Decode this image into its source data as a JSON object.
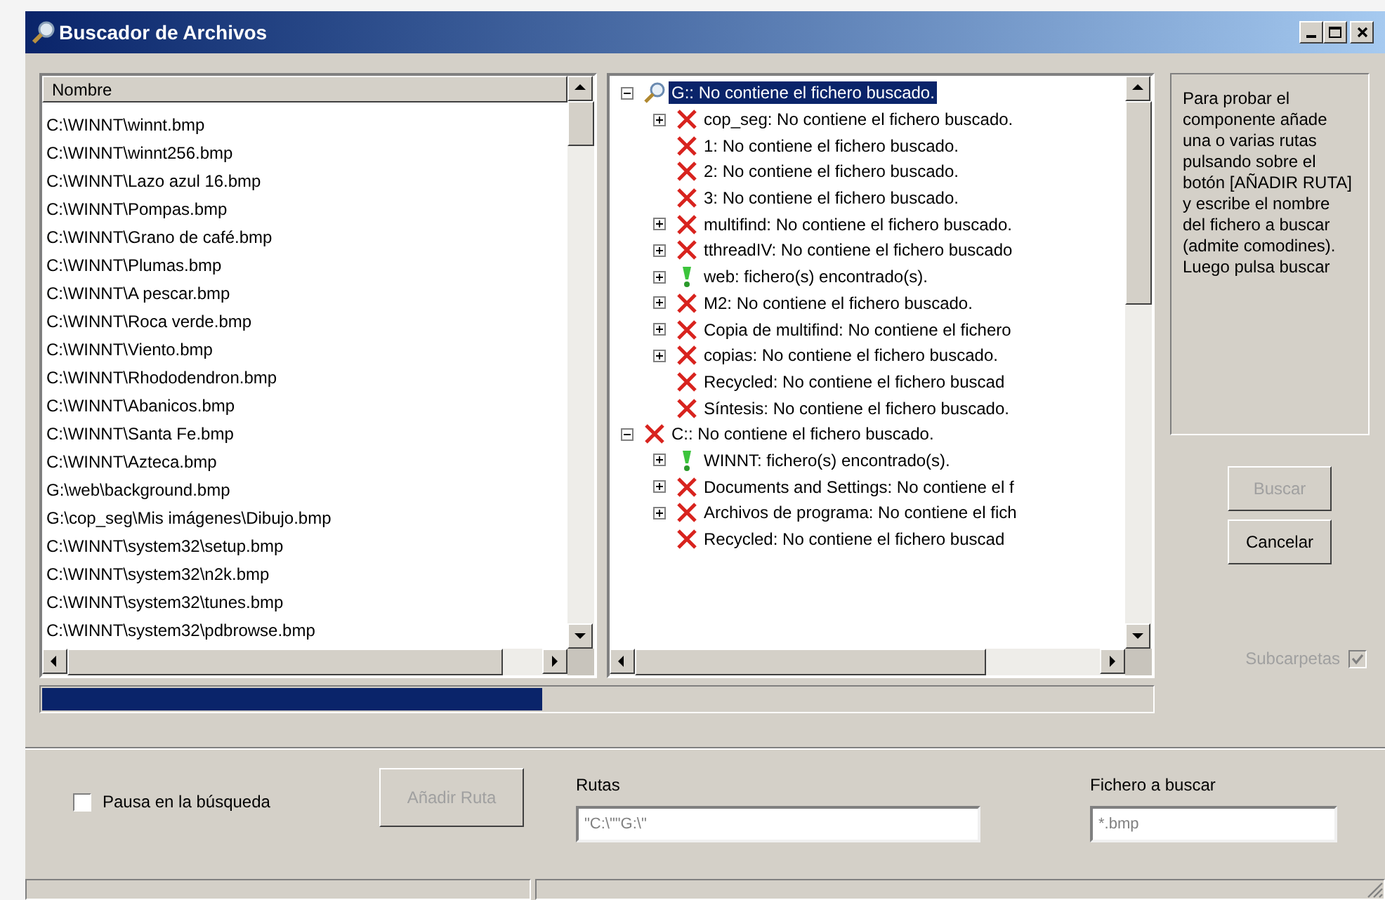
{
  "window": {
    "title": "Buscador de Archivos"
  },
  "file_list": {
    "column": "Nombre",
    "rows": [
      "C:\\WINNT\\winnt.bmp",
      "C:\\WINNT\\winnt256.bmp",
      "C:\\WINNT\\Lazo azul 16.bmp",
      "C:\\WINNT\\Pompas.bmp",
      "C:\\WINNT\\Grano de café.bmp",
      "C:\\WINNT\\Plumas.bmp",
      "C:\\WINNT\\A pescar.bmp",
      "C:\\WINNT\\Roca verde.bmp",
      "C:\\WINNT\\Viento.bmp",
      "C:\\WINNT\\Rhododendron.bmp",
      "C:\\WINNT\\Abanicos.bmp",
      "C:\\WINNT\\Santa Fe.bmp",
      "C:\\WINNT\\Azteca.bmp",
      "G:\\web\\background.bmp",
      "G:\\cop_seg\\Mis imágenes\\Dibujo.bmp",
      "C:\\WINNT\\system32\\setup.bmp",
      "C:\\WINNT\\system32\\n2k.bmp",
      "C:\\WINNT\\system32\\tunes.bmp",
      "C:\\WINNT\\system32\\pdbrowse.bmp"
    ]
  },
  "tree": [
    {
      "label": "G:: No contiene el fichero buscado.",
      "kind": "searching",
      "expanded": true,
      "selected": true,
      "children": [
        {
          "label": "cop_seg: No contiene el fichero buscado.",
          "kind": "not_found",
          "expanded": false,
          "selected": false
        },
        {
          "label": "1: No contiene el fichero buscado.",
          "kind": "not_found",
          "selected": false
        },
        {
          "label": "2: No contiene el fichero buscado.",
          "kind": "not_found",
          "selected": false
        },
        {
          "label": "3: No contiene el fichero buscado.",
          "kind": "not_found",
          "selected": false
        },
        {
          "label": "multifind: No contiene el fichero buscado.",
          "kind": "not_found",
          "expanded": false,
          "selected": false
        },
        {
          "label": "tthreadIV: No contiene el fichero buscado",
          "kind": "not_found",
          "expanded": false,
          "selected": false
        },
        {
          "label": "web: fichero(s) encontrado(s).",
          "kind": "found",
          "expanded": false,
          "selected": false
        },
        {
          "label": "M2: No contiene el fichero buscado.",
          "kind": "not_found",
          "expanded": false,
          "selected": false
        },
        {
          "label": "Copia de multifind: No contiene el fichero",
          "kind": "not_found",
          "expanded": false,
          "selected": false
        },
        {
          "label": "copias: No contiene el fichero buscado.",
          "kind": "not_found",
          "expanded": false,
          "selected": false
        },
        {
          "label": "Recycled: No contiene el fichero buscad",
          "kind": "not_found",
          "selected": false
        },
        {
          "label": "Síntesis: No contiene el fichero buscado.",
          "kind": "not_found",
          "selected": false
        }
      ]
    },
    {
      "label": "C:: No contiene el fichero buscado.",
      "kind": "not_found",
      "expanded": true,
      "selected": false,
      "children": [
        {
          "label": "WINNT: fichero(s) encontrado(s).",
          "kind": "found",
          "expanded": false,
          "selected": false
        },
        {
          "label": "Documents and Settings: No contiene el f",
          "kind": "not_found",
          "expanded": false,
          "selected": false
        },
        {
          "label": "Archivos de programa: No contiene el fich",
          "kind": "not_found",
          "expanded": false,
          "selected": false
        },
        {
          "label": "Recycled: No contiene el fichero buscad",
          "kind": "not_found",
          "selected": false
        }
      ]
    }
  ],
  "progress": {
    "level": 0.45
  },
  "help_text": "Para probar el componente añade una o varias rutas pulsando sobre el botón [AÑADIR RUTA] y escribe el nombre del fichero a buscar (admite comodines). Luego pulsa buscar",
  "actions": [
    {
      "label": "Buscar",
      "disabled": true
    },
    {
      "label": "Cancelar",
      "disabled": false
    }
  ],
  "subfolders": {
    "label": "Subcarpetas",
    "checked": true,
    "disabled": true
  },
  "pause": {
    "label": "Pausa en la búsqueda",
    "checked": false
  },
  "add_path": {
    "label": "Añadir Ruta",
    "disabled": true
  },
  "paths": {
    "label": "Rutas",
    "value": "\"C:\\\"\"G:\\\""
  },
  "file_to_find": {
    "label": "Fichero a buscar",
    "value": "*.bmp"
  }
}
